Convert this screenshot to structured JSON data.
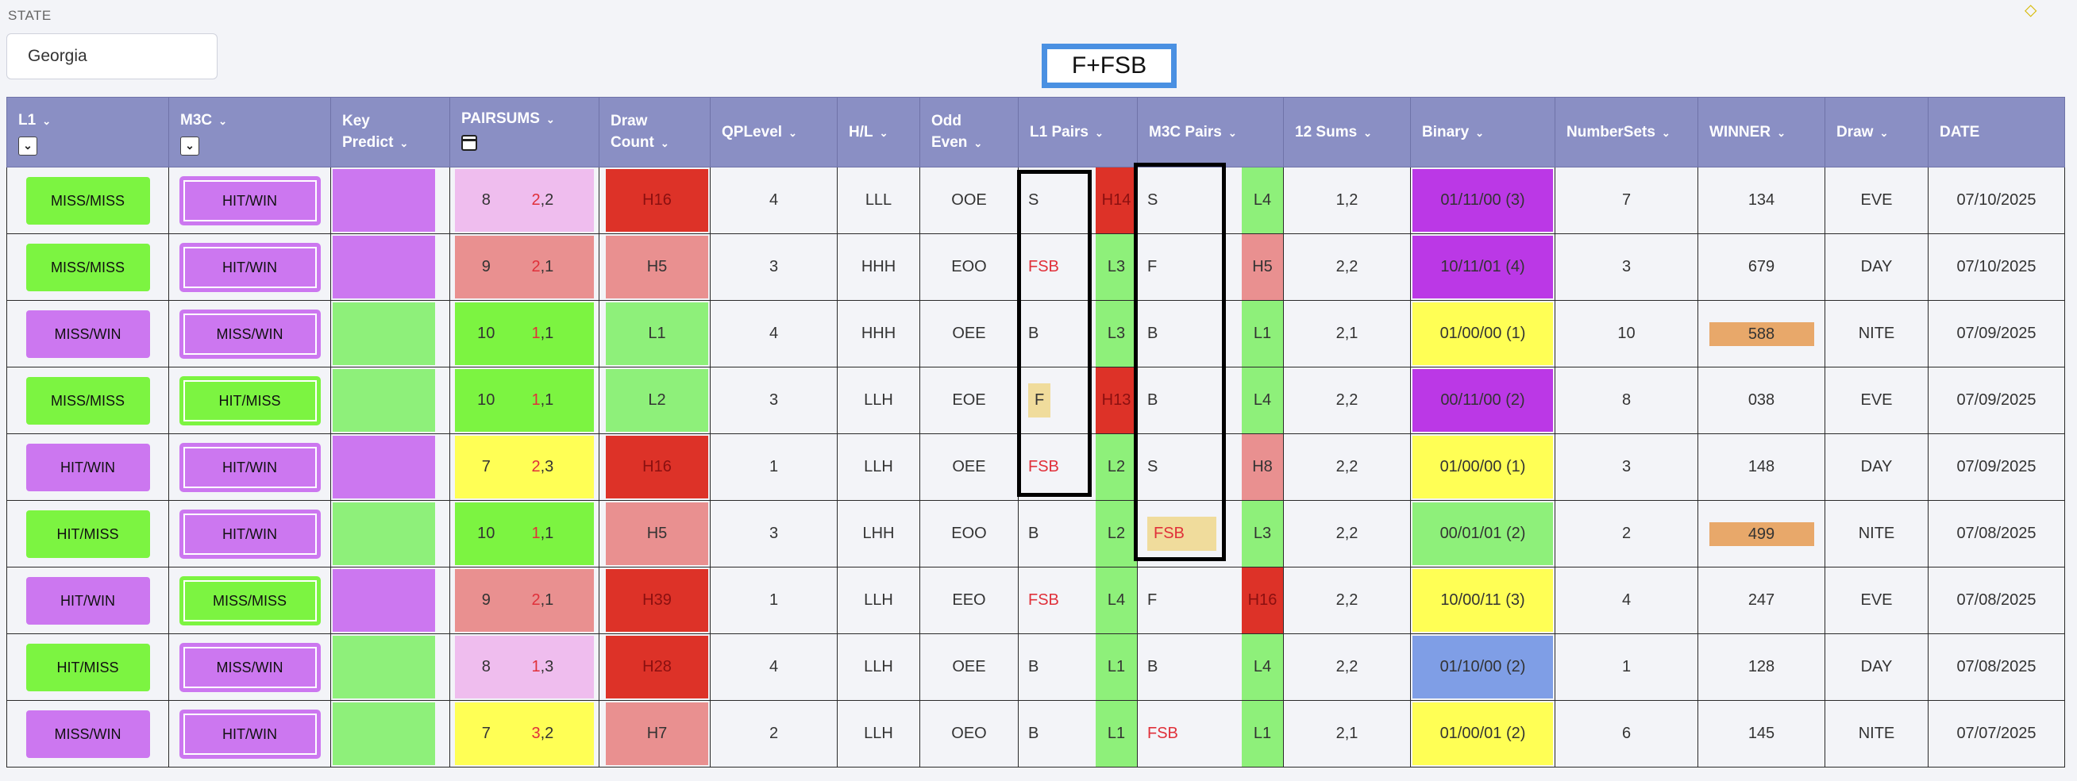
{
  "state": {
    "label": "STATE",
    "value": "Georgia"
  },
  "badge": "F+FSB",
  "headers": {
    "l1": "L1",
    "m3c": "M3C",
    "key_predict_1": "Key",
    "key_predict_2": "Predict",
    "pairsums": "PAIRSUMS",
    "draw_count_1": "Draw",
    "draw_count_2": "Count",
    "qplevel": "QPLevel",
    "hl": "H/L",
    "odd_even_1": "Odd",
    "odd_even_2": "Even",
    "l1_pairs": "L1 Pairs",
    "m3c_pairs": "M3C Pairs",
    "sums12": "12 Sums",
    "binary": "Binary",
    "numbersets": "NumberSets",
    "winner": "WINNER",
    "draw": "Draw",
    "date": "DATE"
  },
  "colors": {
    "green": "#7cf441",
    "purple": "#cc77f0",
    "pink": "#efbdee",
    "salmon": "#e99090",
    "yellow": "#ffff55",
    "red": "#dd3228",
    "lightgreen": "#8ef07a",
    "binpurple": "#bb38e6",
    "blue": "#7f9ee6",
    "tan": "#f0dc9c",
    "orange": "#e8a86a"
  },
  "rows": [
    {
      "l1": "MISS/MISS",
      "l1c": "green",
      "m3c": "HIT/WIN",
      "m3cc": "purple",
      "kp": "purple",
      "ps_a": "8",
      "ps_b1": "2",
      "ps_b2": ",2",
      "psc": "pink",
      "dc": "H16",
      "dcc": "red",
      "qp": "4",
      "hl": "LLL",
      "oe": "OOE",
      "l1p": "S",
      "l1pred": false,
      "l1ptan": false,
      "l1code": "H14",
      "l1codec": "red",
      "m3p": "S",
      "m3pred": false,
      "m3ptan": false,
      "m3code": "L4",
      "m3codec": "lightgreen",
      "s12": "1,2",
      "bin": "01/11/00 (3)",
      "binc": "binpurple",
      "ns": "7",
      "win": "134",
      "winbar": false,
      "draw": "EVE",
      "date": "07/10/2025"
    },
    {
      "l1": "MISS/MISS",
      "l1c": "green",
      "m3c": "HIT/WIN",
      "m3cc": "purple",
      "kp": "purple",
      "ps_a": "9",
      "ps_b1": "2",
      "ps_b2": ",1",
      "psc": "salmon",
      "dc": "H5",
      "dcc": "salmon",
      "qp": "3",
      "hl": "HHH",
      "oe": "EOO",
      "l1p": "FSB",
      "l1pred": true,
      "l1ptan": false,
      "l1code": "L3",
      "l1codec": "lightgreen",
      "m3p": "F",
      "m3pred": false,
      "m3ptan": false,
      "m3code": "H5",
      "m3codec": "salmon",
      "s12": "2,2",
      "bin": "10/11/01 (4)",
      "binc": "binpurple",
      "ns": "3",
      "win": "679",
      "winbar": false,
      "draw": "DAY",
      "date": "07/10/2025"
    },
    {
      "l1": "MISS/WIN",
      "l1c": "purple",
      "m3c": "MISS/WIN",
      "m3cc": "purple",
      "kp": "lightgreen",
      "ps_a": "10",
      "ps_b1": "1",
      "ps_b2": ",1",
      "psc": "green",
      "dc": "L1",
      "dcc": "lightgreen",
      "qp": "4",
      "hl": "HHH",
      "oe": "OEE",
      "l1p": "B",
      "l1pred": false,
      "l1ptan": false,
      "l1code": "L3",
      "l1codec": "lightgreen",
      "m3p": "B",
      "m3pred": false,
      "m3ptan": false,
      "m3code": "L1",
      "m3codec": "lightgreen",
      "s12": "2,1",
      "bin": "01/00/00 (1)",
      "binc": "yellow",
      "ns": "10",
      "win": "588",
      "winbar": true,
      "draw": "NITE",
      "date": "07/09/2025"
    },
    {
      "l1": "MISS/MISS",
      "l1c": "green",
      "m3c": "HIT/MISS",
      "m3cc": "green",
      "kp": "lightgreen",
      "ps_a": "10",
      "ps_b1": "1",
      "ps_b2": ",1",
      "psc": "green",
      "dc": "L2",
      "dcc": "lightgreen",
      "qp": "3",
      "hl": "LLH",
      "oe": "EOE",
      "l1p": "F",
      "l1pred": false,
      "l1ptan": true,
      "l1code": "H13",
      "l1codec": "red",
      "m3p": "B",
      "m3pred": false,
      "m3ptan": false,
      "m3code": "L4",
      "m3codec": "lightgreen",
      "s12": "2,2",
      "bin": "00/11/00 (2)",
      "binc": "binpurple",
      "ns": "8",
      "win": "038",
      "winbar": false,
      "draw": "EVE",
      "date": "07/09/2025"
    },
    {
      "l1": "HIT/WIN",
      "l1c": "purple",
      "m3c": "HIT/WIN",
      "m3cc": "purple",
      "kp": "purple",
      "ps_a": "7",
      "ps_b1": "2",
      "ps_b2": ",3",
      "psc": "yellow",
      "dc": "H16",
      "dcc": "red",
      "qp": "1",
      "hl": "LLH",
      "oe": "OEE",
      "l1p": "FSB",
      "l1pred": true,
      "l1ptan": false,
      "l1code": "L2",
      "l1codec": "lightgreen",
      "m3p": "S",
      "m3pred": false,
      "m3ptan": false,
      "m3code": "H8",
      "m3codec": "salmon",
      "s12": "2,2",
      "bin": "01/00/00 (1)",
      "binc": "yellow",
      "ns": "3",
      "win": "148",
      "winbar": false,
      "draw": "DAY",
      "date": "07/09/2025"
    },
    {
      "l1": "HIT/MISS",
      "l1c": "green",
      "m3c": "HIT/WIN",
      "m3cc": "purple",
      "kp": "lightgreen",
      "ps_a": "10",
      "ps_b1": "1",
      "ps_b2": ",1",
      "psc": "green",
      "dc": "H5",
      "dcc": "salmon",
      "qp": "3",
      "hl": "LHH",
      "oe": "EOO",
      "l1p": "B",
      "l1pred": false,
      "l1ptan": false,
      "l1code": "L2",
      "l1codec": "lightgreen",
      "m3p": "FSB",
      "m3pred": true,
      "m3ptan": true,
      "m3code": "L3",
      "m3codec": "lightgreen",
      "s12": "2,2",
      "bin": "00/01/01 (2)",
      "binc": "lightgreen",
      "ns": "2",
      "win": "499",
      "winbar": true,
      "draw": "NITE",
      "date": "07/08/2025"
    },
    {
      "l1": "HIT/WIN",
      "l1c": "purple",
      "m3c": "MISS/MISS",
      "m3cc": "green",
      "kp": "purple",
      "ps_a": "9",
      "ps_b1": "2",
      "ps_b2": ",1",
      "psc": "salmon",
      "dc": "H39",
      "dcc": "red",
      "qp": "1",
      "hl": "LLH",
      "oe": "EEO",
      "l1p": "FSB",
      "l1pred": true,
      "l1ptan": false,
      "l1code": "L4",
      "l1codec": "lightgreen",
      "m3p": "F",
      "m3pred": false,
      "m3ptan": false,
      "m3code": "H16",
      "m3codec": "red",
      "s12": "2,2",
      "bin": "10/00/11 (3)",
      "binc": "yellow",
      "ns": "4",
      "win": "247",
      "winbar": false,
      "draw": "EVE",
      "date": "07/08/2025"
    },
    {
      "l1": "HIT/MISS",
      "l1c": "green",
      "m3c": "MISS/WIN",
      "m3cc": "purple",
      "kp": "lightgreen",
      "ps_a": "8",
      "ps_b1": "1",
      "ps_b2": ",3",
      "psc": "pink",
      "dc": "H28",
      "dcc": "red",
      "qp": "4",
      "hl": "LLH",
      "oe": "OEE",
      "l1p": "B",
      "l1pred": false,
      "l1ptan": false,
      "l1code": "L1",
      "l1codec": "lightgreen",
      "m3p": "B",
      "m3pred": false,
      "m3ptan": false,
      "m3code": "L4",
      "m3codec": "lightgreen",
      "s12": "2,2",
      "bin": "01/10/00 (2)",
      "binc": "blue",
      "ns": "1",
      "win": "128",
      "winbar": false,
      "draw": "DAY",
      "date": "07/08/2025"
    },
    {
      "l1": "MISS/WIN",
      "l1c": "purple",
      "m3c": "HIT/WIN",
      "m3cc": "purple",
      "kp": "lightgreen",
      "ps_a": "7",
      "ps_b1": "3",
      "ps_b2": ",2",
      "psc": "yellow",
      "dc": "H7",
      "dcc": "salmon",
      "qp": "2",
      "hl": "LLH",
      "oe": "OEO",
      "l1p": "B",
      "l1pred": false,
      "l1ptan": false,
      "l1code": "L1",
      "l1codec": "lightgreen",
      "m3p": "FSB",
      "m3pred": true,
      "m3ptan": false,
      "m3code": "L1",
      "m3codec": "lightgreen",
      "s12": "2,1",
      "bin": "01/00/01 (2)",
      "binc": "yellow",
      "ns": "6",
      "win": "145",
      "winbar": false,
      "draw": "NITE",
      "date": "07/07/2025"
    }
  ]
}
